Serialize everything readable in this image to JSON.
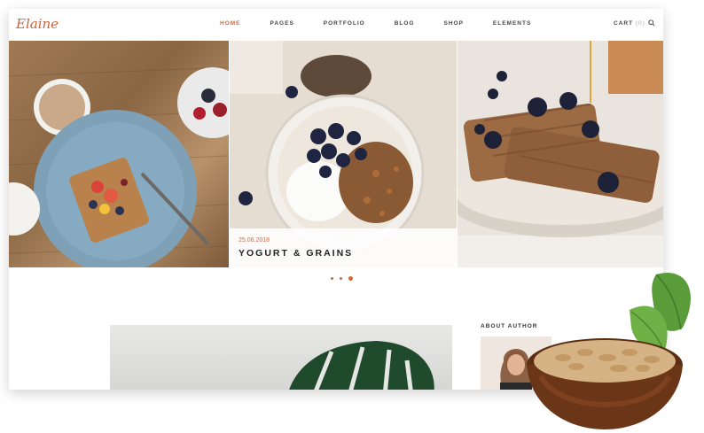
{
  "header": {
    "logo": "Elaine",
    "nav": [
      "HOME",
      "PAGES",
      "PORTFOLIO",
      "BLOG",
      "SHOP",
      "ELEMENTS"
    ],
    "active_nav": "HOME",
    "cart_label": "CART",
    "cart_count": "(0)"
  },
  "slider": {
    "caption_date": "25.06.2018",
    "caption_title": "YOGURT & GRAINS",
    "dots_count": 3,
    "active_dot": 3
  },
  "sidebar": {
    "about_title": "ABOUT AUTHOR"
  },
  "colors": {
    "accent": "#d3683e",
    "text": "#222222"
  },
  "icons": [
    "search-icon",
    "mint-leaf",
    "oat-bowl"
  ]
}
